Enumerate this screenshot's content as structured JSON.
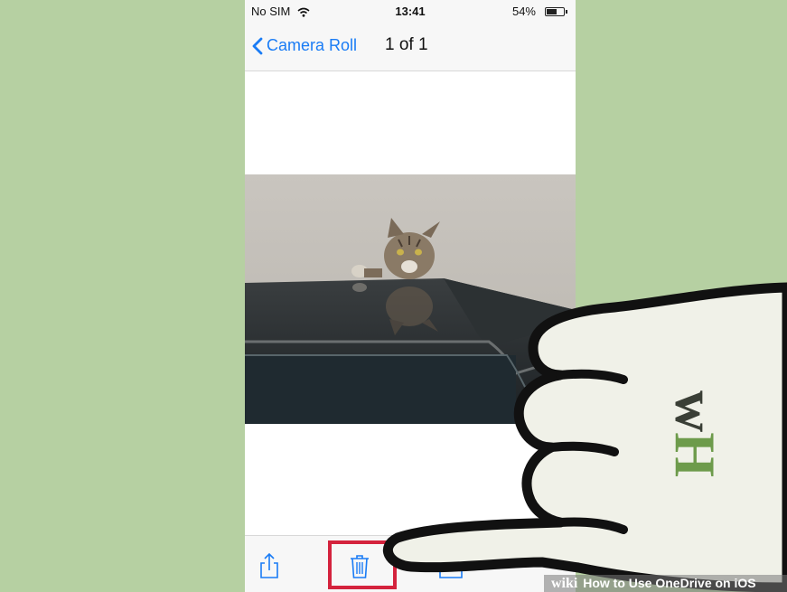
{
  "colors": {
    "background": "#b6d0a2",
    "ios_blue": "#1a7cf5",
    "highlight_red": "#d4233d",
    "logo_green": "#6d9b4b"
  },
  "status_bar": {
    "carrier": "No SIM",
    "time": "13:41",
    "battery_percent": "54%",
    "battery_level": 0.54
  },
  "nav_bar": {
    "back_label": "Camera Roll",
    "title": "1 of 1"
  },
  "photo": {
    "subject": "cat-on-glass-table"
  },
  "toolbar": {
    "icons": [
      "share-icon",
      "trash-icon",
      "folder-icon",
      "more-icon"
    ],
    "highlighted": "trash-icon"
  },
  "watermark": {
    "brand": "wiki",
    "text": "How to Use OneDrive on iOS",
    "logo": "wH"
  }
}
